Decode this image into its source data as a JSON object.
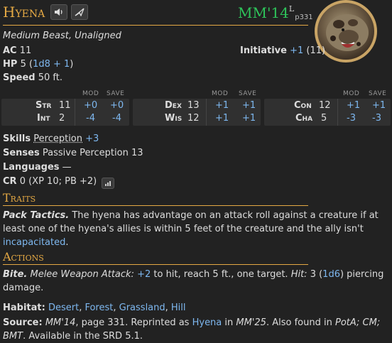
{
  "header": {
    "name": "Hyena",
    "source": "MM'14",
    "source_sup": "L",
    "source_page": "p331"
  },
  "type_line": "Medium Beast, Unaligned",
  "ac": {
    "label": "AC",
    "value": "11"
  },
  "initiative": {
    "label": "Initiative",
    "mod": "+1",
    "score": "(11)"
  },
  "hp": {
    "label": "HP",
    "value": "5",
    "dice": "1d8 + 1"
  },
  "speed": {
    "label": "Speed",
    "value": "50 ft."
  },
  "abilities_headers": {
    "mod": "MOD",
    "save": "SAVE"
  },
  "abilities": [
    {
      "name": "Str",
      "score": "11",
      "mod": "+0",
      "save": "+0"
    },
    {
      "name": "Int",
      "score": "2",
      "mod": "-4",
      "save": "-4"
    },
    {
      "name": "Dex",
      "score": "13",
      "mod": "+1",
      "save": "+1"
    },
    {
      "name": "Wis",
      "score": "12",
      "mod": "+1",
      "save": "+1"
    },
    {
      "name": "Con",
      "score": "12",
      "mod": "+1",
      "save": "+1"
    },
    {
      "name": "Cha",
      "score": "5",
      "mod": "-3",
      "save": "-3"
    }
  ],
  "skills": {
    "label": "Skills",
    "skill": "Perception",
    "bonus": "+3"
  },
  "senses": {
    "label": "Senses",
    "value": "Passive Perception 13"
  },
  "languages": {
    "label": "Languages",
    "value": "—"
  },
  "cr": {
    "label": "CR",
    "value": "0 (XP 10; PB +2)"
  },
  "traits": {
    "title": "Traits",
    "name": "Pack Tactics.",
    "text1": " The hyena has advantage on an attack roll against a creature if at least one of the hyena's allies is within 5 feet of the creature and the ally isn't ",
    "link": "incapacitated",
    "text2": "."
  },
  "actions": {
    "title": "Actions",
    "name": "Bite.",
    "attack_type": " Melee Weapon Attack:",
    "to_hit": "+2",
    "text1": " to hit, reach 5 ft., one target. ",
    "hit_label": "Hit:",
    "dmg": " 3 (",
    "dice": "1d6",
    "text2": ") piercing damage."
  },
  "habitat": {
    "label": "Habitat:",
    "items": [
      "Desert",
      "Forest",
      "Grassland",
      "Hill"
    ]
  },
  "source_line": {
    "label": "Source:",
    "book": "MM'14",
    "t1": ", page 331. Reprinted as ",
    "reprint": "Hyena",
    "t2": " in ",
    "book2": "MM'25",
    "t3": ". Also found in ",
    "also": "PotA; CM; BMT",
    "t4": ". Available in the SRD 5.1."
  },
  "colors": {
    "accent": "#e5a944",
    "source_green": "#2ec45a",
    "link": "#7eb8f0",
    "background": "#222222"
  },
  "icons": {
    "sound": "speaker-icon",
    "share": "send-icon",
    "cr_tool": "bar-chart-icon"
  }
}
